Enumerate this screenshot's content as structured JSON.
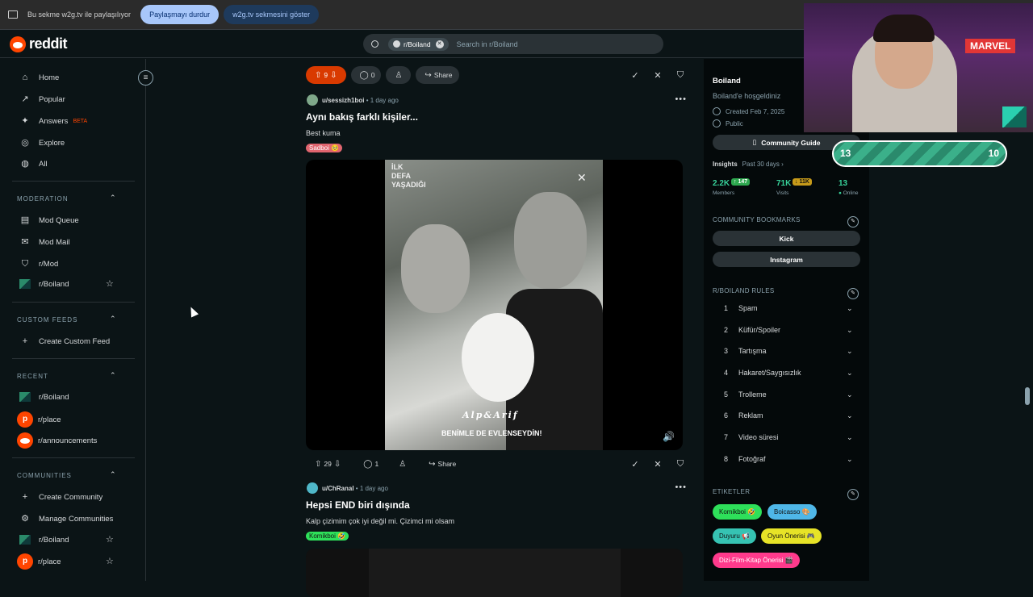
{
  "share_bar": {
    "message": "Bu sekme w2g.tv ile paylaşılıyor",
    "stop_label": "Paylaşmayı durdur",
    "show_label": "w2g.tv sekmesini göster"
  },
  "header": {
    "logo_text": "reddit",
    "search_chip": "r/Boiland",
    "search_placeholder": "Search in r/Boiland"
  },
  "sidebar": {
    "main": [
      {
        "label": "Home",
        "icon": "home-icon",
        "glyph": "⌂"
      },
      {
        "label": "Popular",
        "icon": "popular-icon",
        "glyph": "↗"
      },
      {
        "label": "Answers",
        "icon": "answers-icon",
        "glyph": "✦",
        "badge": "BETA"
      },
      {
        "label": "Explore",
        "icon": "explore-icon",
        "glyph": "◎"
      },
      {
        "label": "All",
        "icon": "all-icon",
        "glyph": "◍"
      }
    ],
    "moderation_title": "MODERATION",
    "moderation": [
      "Mod Queue",
      "Mod Mail",
      "r/Mod",
      "r/Boiland"
    ],
    "custom_feeds_title": "CUSTOM FEEDS",
    "create_custom_feed": "Create Custom Feed",
    "recent_title": "RECENT",
    "recent": [
      "r/Boiland",
      "r/place",
      "r/announcements"
    ],
    "communities_title": "COMMUNITIES",
    "create_community": "Create Community",
    "manage_communities": "Manage Communities",
    "communities": [
      "r/Boiland",
      "r/place"
    ]
  },
  "feed": {
    "top_actions": {
      "votes": "9",
      "comments": "0",
      "share": "Share"
    },
    "post1": {
      "user": "u/sessizh1boi",
      "age": "1 day ago",
      "title": "Aynı bakış farklı kişiler...",
      "body": "Best kuma",
      "flair": "Sadboi 🥺",
      "overlay": "İLK\nDEFA\nYAŞADIĞI",
      "caption_name": "Alp&Arif",
      "caption_sub": "BENİMLE DE EVLENSEYDİN!",
      "votes": "29",
      "comments": "1",
      "share": "Share"
    },
    "post2": {
      "user": "u/ChRanal",
      "age": "1 day ago",
      "title": "Hepsi END biri dışında",
      "body": "Kalp çizimim çok iyi değil mi. Çizimci mi olsam",
      "flair": "Komikboi 🤣"
    }
  },
  "right": {
    "title": "Boiland",
    "description": "Boiland'e hoşgeldiniz",
    "created": "Created Feb 7, 2025",
    "visibility": "Public",
    "guide": "Community Guide",
    "insights_label": "Insights",
    "insights_period": "Past 30 days ›",
    "members": "2.2K",
    "members_delta": "↑ 147",
    "members_label": "Members",
    "visits": "71K",
    "visits_delta": "↓ 11K",
    "visits_label": "Visits",
    "online": "13",
    "online_label": "Online",
    "bookmarks_title": "COMMUNITY BOOKMARKS",
    "bookmarks": [
      "Kick",
      "Instagram"
    ],
    "rules_title": "R/BOILAND RULES",
    "rules": [
      {
        "n": "1",
        "t": "Spam"
      },
      {
        "n": "2",
        "t": "Küfür/Spoiler"
      },
      {
        "n": "3",
        "t": "Tartışma"
      },
      {
        "n": "4",
        "t": "Hakaret/Saygısızlık"
      },
      {
        "n": "5",
        "t": "Trolleme"
      },
      {
        "n": "6",
        "t": "Reklam"
      },
      {
        "n": "7",
        "t": "Video süresi"
      },
      {
        "n": "8",
        "t": "Fotoğraf"
      }
    ],
    "tags_title": "ETIKETLER",
    "tags": [
      {
        "label": "Komikboi 🤣",
        "color": "#2ee05a"
      },
      {
        "label": "Boicasso 🎨",
        "color": "#4fb7e8"
      },
      {
        "label": "Duyuru 📢",
        "color": "#36c3b3"
      },
      {
        "label": "Oyun Önerisi 🎮",
        "color": "#e7e327"
      },
      {
        "label": "Dizi-Film-Kitap Önerisi 🎬",
        "color": "#ff3a8c"
      }
    ]
  },
  "overlay": {
    "marvel": "MARVEL",
    "score_left": "13",
    "score_right": "10"
  }
}
